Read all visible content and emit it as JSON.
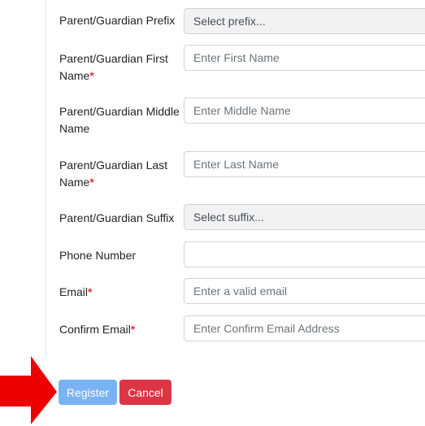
{
  "form": {
    "fields": [
      {
        "label": "Parent/Guardian Prefix",
        "required": false,
        "type": "select",
        "value": "Select prefix..."
      },
      {
        "label": "Parent/Guardian First Name",
        "required": true,
        "type": "input",
        "placeholder": "Enter First Name"
      },
      {
        "label": "Parent/Guardian Middle Name",
        "required": false,
        "type": "input",
        "placeholder": "Enter Middle Name"
      },
      {
        "label": "Parent/Guardian Last Name",
        "required": true,
        "type": "input",
        "placeholder": "Enter Last Name"
      },
      {
        "label": "Parent/Guardian Suffix",
        "required": false,
        "type": "select",
        "value": "Select suffix..."
      },
      {
        "label": "Phone Number",
        "required": false,
        "type": "input",
        "placeholder": ""
      },
      {
        "label": "Email",
        "required": true,
        "type": "input",
        "placeholder": "Enter a valid email"
      },
      {
        "label": "Confirm Email",
        "required": true,
        "type": "input",
        "placeholder": "Enter Confirm Email Address"
      }
    ],
    "required_marker": "*"
  },
  "actions": {
    "register_label": "Register",
    "cancel_label": "Cancel"
  },
  "colors": {
    "required_marker": "#dc3545",
    "register_button": "#7ab3f3",
    "cancel_button": "#dc3545",
    "annotation_arrow": "#ee0000"
  },
  "annotation": {
    "icon": "right-arrow-icon"
  }
}
